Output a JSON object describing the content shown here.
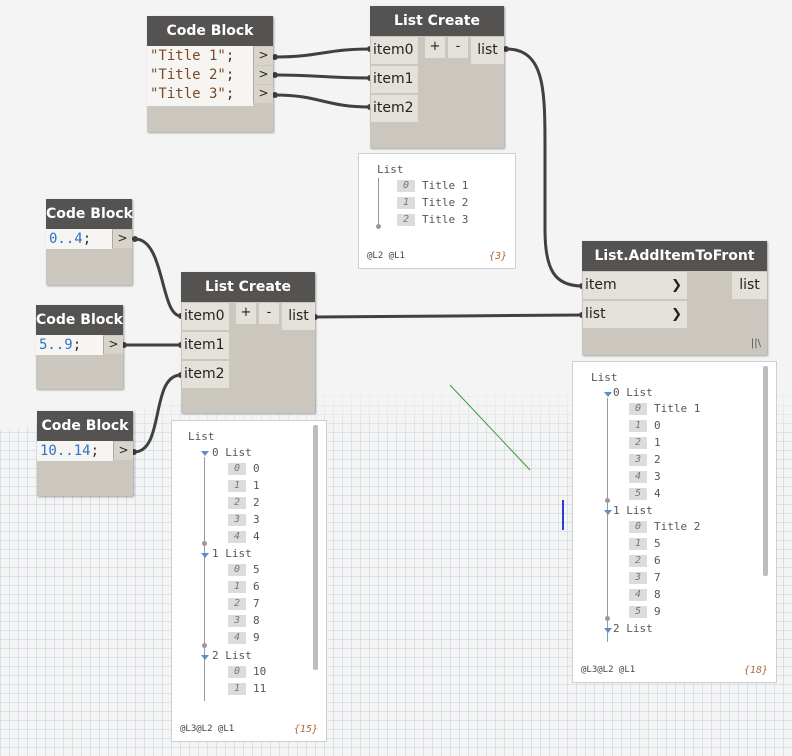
{
  "code_blocks": [
    {
      "title": "Code Block",
      "lines": [
        {
          "code": "\"Title 1\"",
          "semi": ";",
          "port": ">"
        },
        {
          "code": "\"Title 2\"",
          "semi": ";",
          "port": ">"
        },
        {
          "code": "\"Title 3\"",
          "semi": ";",
          "port": ">"
        }
      ]
    },
    {
      "title": "Code Block",
      "lines": [
        {
          "code": "0..4",
          "semi": ";",
          "port": ">"
        }
      ]
    },
    {
      "title": "Code Block",
      "lines": [
        {
          "code": "5..9",
          "semi": ";",
          "port": ">"
        }
      ]
    },
    {
      "title": "Code Block",
      "lines": [
        {
          "code": "10..14",
          "semi": ";",
          "port": ">"
        }
      ]
    }
  ],
  "list_create_top": {
    "title": "List Create",
    "inputs": [
      "item0",
      "item1",
      "item2"
    ],
    "plus": "+",
    "minus": "-",
    "output": "list"
  },
  "list_create_mid": {
    "title": "List Create",
    "inputs": [
      "item0",
      "item1",
      "item2"
    ],
    "plus": "+",
    "minus": "-",
    "output": "list"
  },
  "add_item": {
    "title": "List.AddItemToFront",
    "inputs": [
      "item",
      "list"
    ],
    "output": "list",
    "lacing": "||\\"
  },
  "watch_top": {
    "root": "List",
    "items": [
      [
        "0",
        "Title 1"
      ],
      [
        "1",
        "Title 2"
      ],
      [
        "2",
        "Title 3"
      ]
    ],
    "levels": "@L2 @L1",
    "count": "{3}"
  },
  "watch_mid": {
    "root": "List",
    "groups": [
      {
        "label": "0 List",
        "items": [
          [
            "0",
            "0"
          ],
          [
            "1",
            "1"
          ],
          [
            "2",
            "2"
          ],
          [
            "3",
            "3"
          ],
          [
            "4",
            "4"
          ]
        ]
      },
      {
        "label": "1 List",
        "items": [
          [
            "0",
            "5"
          ],
          [
            "1",
            "6"
          ],
          [
            "2",
            "7"
          ],
          [
            "3",
            "8"
          ],
          [
            "4",
            "9"
          ]
        ]
      },
      {
        "label": "2 List",
        "items": [
          [
            "0",
            "10"
          ],
          [
            "1",
            "11"
          ]
        ]
      }
    ],
    "levels": "@L3@L2 @L1",
    "count": "{15}"
  },
  "watch_right": {
    "root": "List",
    "groups": [
      {
        "label": "0 List",
        "items": [
          [
            "0",
            "Title 1"
          ],
          [
            "1",
            "0"
          ],
          [
            "2",
            "1"
          ],
          [
            "3",
            "2"
          ],
          [
            "4",
            "3"
          ],
          [
            "5",
            "4"
          ]
        ]
      },
      {
        "label": "1 List",
        "items": [
          [
            "0",
            "Title 2"
          ],
          [
            "1",
            "5"
          ],
          [
            "2",
            "6"
          ],
          [
            "3",
            "7"
          ],
          [
            "4",
            "8"
          ],
          [
            "5",
            "9"
          ]
        ]
      },
      {
        "label": "2 List",
        "items": []
      }
    ],
    "levels": "@L3@L2 @L1",
    "count": "{18}"
  },
  "colors": {
    "header": "#555351",
    "node_body": "#cbc6be",
    "port": "#e4e1db",
    "wire": "#404040",
    "grid": "#bcd0dc"
  }
}
